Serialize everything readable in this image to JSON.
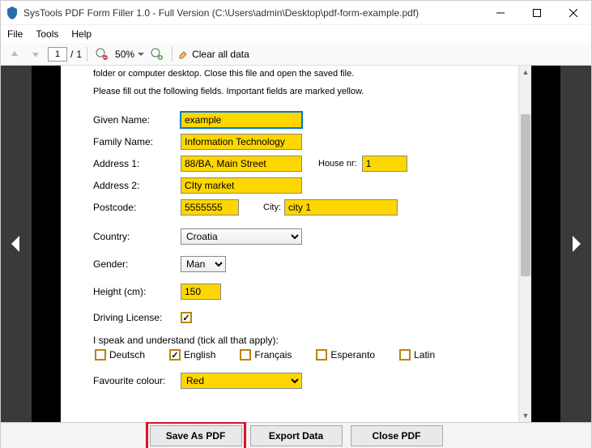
{
  "window": {
    "title": "SysTools PDF Form Filler 1.0 - Full Version (C:\\Users\\admin\\Desktop\\pdf-form-example.pdf)"
  },
  "menu": {
    "file": "File",
    "tools": "Tools",
    "help": "Help"
  },
  "toolbar": {
    "page_current": "1",
    "page_sep": "/",
    "page_total": "1",
    "zoom": "50%",
    "clear_label": "Clear all data"
  },
  "doc": {
    "intro1": "folder or computer desktop. Close this file and open the saved file.",
    "intro2": "Please fill out the following fields. Important fields are marked yellow.",
    "labels": {
      "given": "Given Name:",
      "family": "Family Name:",
      "addr1": "Address 1:",
      "addr2": "Address 2:",
      "house": "House nr:",
      "postcode": "Postcode:",
      "city": "City:",
      "country": "Country:",
      "gender": "Gender:",
      "height": "Height (cm):",
      "license": "Driving License:",
      "lang_intro": "I speak and understand (tick all that apply):",
      "fav": "Favourite colour:"
    },
    "values": {
      "given": "example",
      "family": "Information Technology",
      "addr1": "88/BA, Main Street",
      "addr2": "CIty market",
      "house": "1",
      "postcode": "5555555",
      "city": "city 1",
      "country": "Croatia",
      "gender": "Man",
      "height": "150",
      "license_checked": "✓",
      "fav": "Red"
    },
    "langs": {
      "de": "Deutsch",
      "en": "English",
      "fr": "Français",
      "eo": "Esperanto",
      "la": "Latin",
      "en_checked": "✓"
    }
  },
  "footer": {
    "save": "Save As PDF",
    "export": "Export Data",
    "close": "Close PDF"
  }
}
